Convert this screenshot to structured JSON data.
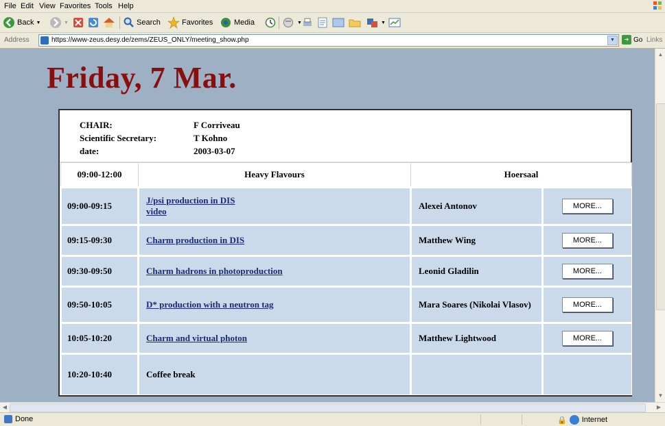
{
  "browser": {
    "menu": [
      "File",
      "Edit",
      "View",
      "Favorites",
      "Tools",
      "Help"
    ],
    "toolbar": {
      "back": "Back",
      "search": "Search",
      "favorites": "Favorites",
      "media": "Media"
    },
    "address": {
      "label": "Address",
      "url": "https://www-zeus.desy.de/zems/ZEUS_ONLY/meeting_show.php",
      "go": "Go",
      "links": "Links"
    },
    "status": {
      "text": "Done",
      "zone": "Internet"
    }
  },
  "page": {
    "day_title": "Friday, 7 Mar.",
    "meta": [
      {
        "label": "CHAIR:",
        "value": "F Corriveau"
      },
      {
        "label": "Scientific Secretary:",
        "value": "T Kohno"
      },
      {
        "label": "date:",
        "value": "2003-03-07"
      }
    ],
    "session": {
      "time": "09:00-12:00",
      "title": "Heavy Flavours",
      "room": "Hoersaal"
    },
    "talks": [
      {
        "time": "09:00-09:15",
        "title": "J/psi production in DIS",
        "extra": "video",
        "speaker": "Alexei Antonov",
        "more": "MORE..."
      },
      {
        "time": "09:15-09:30",
        "title": "Charm production in DIS",
        "speaker": "Matthew Wing",
        "more": "MORE..."
      },
      {
        "time": "09:30-09:50",
        "title": "Charm hadrons in photoproduction",
        "speaker": "Leonid Gladilin",
        "more": "MORE..."
      },
      {
        "time": "09:50-10:05",
        "title": "D* production with a neutron tag",
        "speaker": "Mara Soares (Nikolai Vlasov)",
        "more": "MORE..."
      },
      {
        "time": "10:05-10:20",
        "title": "Charm and virtual photon",
        "speaker": "Matthew Lightwood",
        "more": "MORE..."
      },
      {
        "time": "10:20-10:40",
        "title": "Coffee break",
        "speaker": "",
        "more": ""
      }
    ]
  },
  "colors": {
    "title_red": "#8b0e0e",
    "page_bg": "#9db0c4",
    "row_bg": "#cbdaeb",
    "link": "#1a2a77"
  }
}
